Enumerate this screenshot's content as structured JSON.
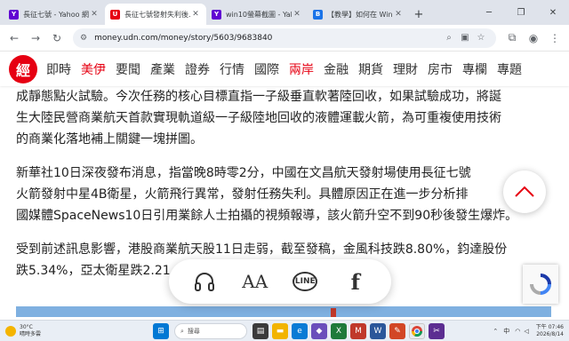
{
  "browser": {
    "tabs": [
      {
        "favicon": "Y",
        "title": "長征七號 - Yahoo 網路..."
      },
      {
        "favicon": "U",
        "title": "長征七號發射失利後..."
      },
      {
        "favicon": "Y",
        "title": "win10螢幕截圖 - Yahoo..."
      },
      {
        "favicon": "B",
        "title": "【教學】如何在 Windo..."
      }
    ],
    "url": "money.udn.com/money/story/5603/9683840"
  },
  "site": {
    "logo": "經",
    "nav": [
      "即時",
      "美伊",
      "要聞",
      "產業",
      "證券",
      "行情",
      "國際",
      "兩岸",
      "金融",
      "期貨",
      "理財",
      "房市",
      "專欄",
      "專題"
    ]
  },
  "article": {
    "paragraphs": [
      [
        "成靜態點火試驗。今次任務的核心目標直指一子級垂直軟著陸回收，如果試驗成功，將誕",
        "生大陸民營商業航天首款實現軌道級一子級陸地回收的液體運載火箭，為可重複使用技術",
        "的商業化落地補上關鍵一塊拼圖。"
      ],
      [
        "新華社10日深夜發布消息，指當晚8時零2分，中國在文昌航天發射場使用長征七號",
        "火箭發射中星4B衛星，火箭飛行異常，發射任務失利。具體原因正在進一步分析排",
        "國媒體SpaceNews10日引用業餘人士拍攝的視頻報導，該火箭升空不到90秒後發生爆炸。"
      ],
      [
        "受到前述訊息影響，港股商業航天股11日走弱，截至發稿，金風科技跌8.80%，鈞達股份",
        "跌5.34%，亞太衛星跌2.21"
      ]
    ]
  },
  "share_bar": {
    "font_size_label": "AA",
    "line_label": "LINE",
    "facebook_label": "f"
  },
  "taskbar": {
    "weather_temp": "30°C",
    "weather_desc": "晴時多雲",
    "search_placeholder": "搜尋",
    "ime": "中",
    "time": "下午 07:46",
    "date": "2026/8/14"
  }
}
